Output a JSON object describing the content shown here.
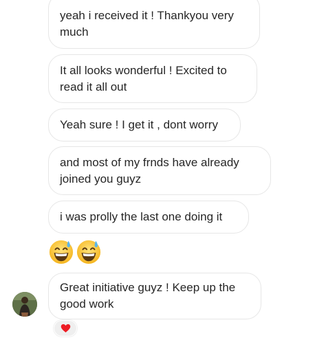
{
  "messages": [
    {
      "text": "yeah i received it ! Thankyou very much"
    },
    {
      "text": "It all looks wonderful ! Excited to read it all out"
    },
    {
      "text": "Yeah sure ! I get it , dont worry"
    },
    {
      "text": "and most of my frnds have already joined you guyz"
    },
    {
      "text": "i was prolly the last one doing it"
    },
    {
      "emojis": [
        "grinning-face-with-sweat",
        "grinning-face-with-sweat"
      ]
    },
    {
      "text": "Great initiative guyz ! Keep up the good work",
      "reaction": "red-heart"
    }
  ],
  "colors": {
    "bubble_border": "#e6e6e6",
    "text": "#262626",
    "reaction_bg": "#efefef",
    "heart": "#ed1c24"
  }
}
